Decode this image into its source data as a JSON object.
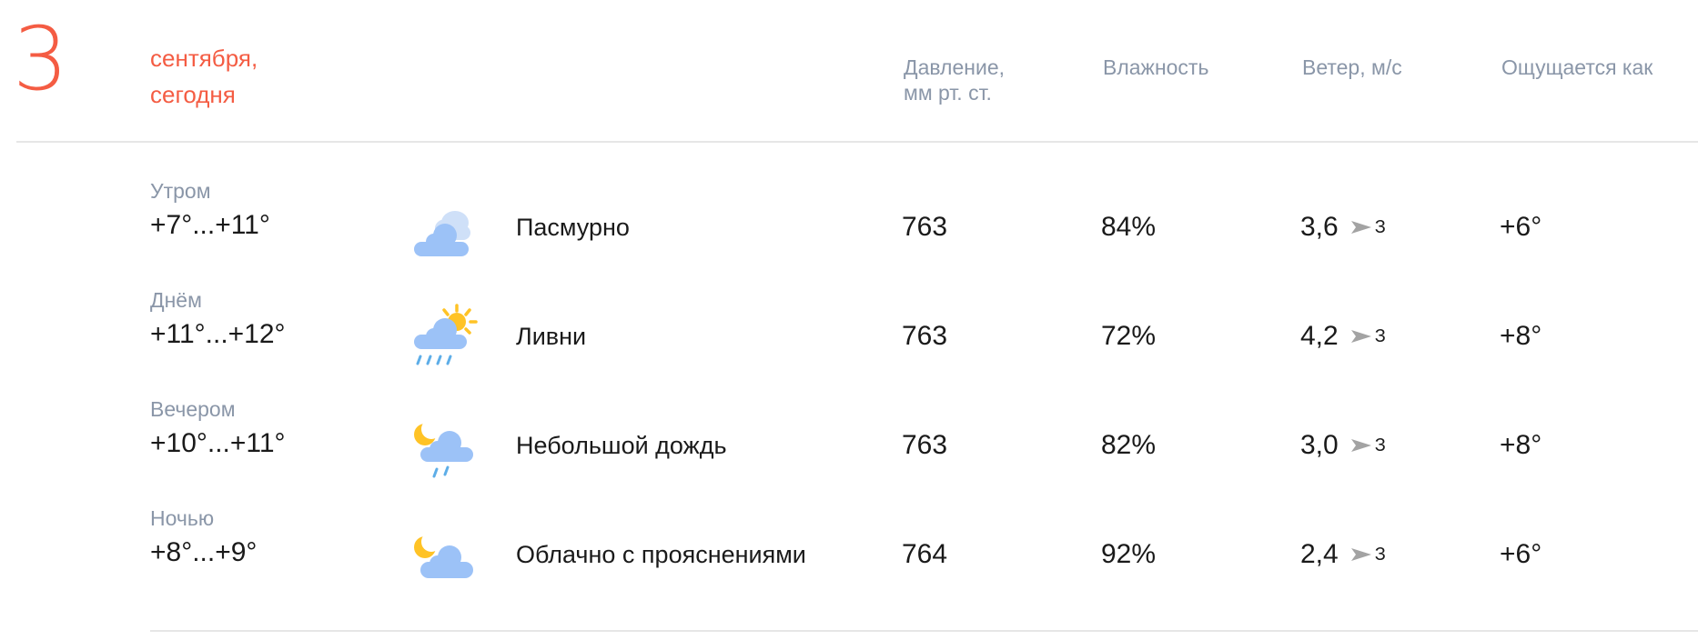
{
  "header": {
    "day_number": "3",
    "month_line": "сентября,",
    "day_line": "сегодня",
    "columns": {
      "pressure_line1": "Давление,",
      "pressure_line2": "мм рт. ст.",
      "humidity": "Влажность",
      "wind": "Ветер, м/с",
      "feels_like": "Ощущается как"
    }
  },
  "colors": {
    "accent": "#f45c43",
    "muted": "#8a96a8",
    "cloud": "#9cc2f7",
    "sun": "#ffc326",
    "rain": "#5eaee8"
  },
  "rows": [
    {
      "period": "Утром",
      "temp": "+7°...+11°",
      "icon": "overcast-icon",
      "condition": "Пасмурно",
      "pressure": "763",
      "humidity": "84%",
      "wind_speed": "3,6",
      "wind_dir": "З",
      "feels": "+6°"
    },
    {
      "period": "Днём",
      "temp": "+11°...+12°",
      "icon": "sun-showers-icon",
      "condition": "Ливни",
      "pressure": "763",
      "humidity": "72%",
      "wind_speed": "4,2",
      "wind_dir": "З",
      "feels": "+8°"
    },
    {
      "period": "Вечером",
      "temp": "+10°...+11°",
      "icon": "night-light-rain-icon",
      "condition": "Небольшой дождь",
      "pressure": "763",
      "humidity": "82%",
      "wind_speed": "3,0",
      "wind_dir": "З",
      "feels": "+8°"
    },
    {
      "period": "Ночью",
      "temp": "+8°...+9°",
      "icon": "night-partly-cloudy-icon",
      "condition": "Облачно с прояснениями",
      "pressure": "764",
      "humidity": "92%",
      "wind_speed": "2,4",
      "wind_dir": "З",
      "feels": "+6°"
    }
  ]
}
